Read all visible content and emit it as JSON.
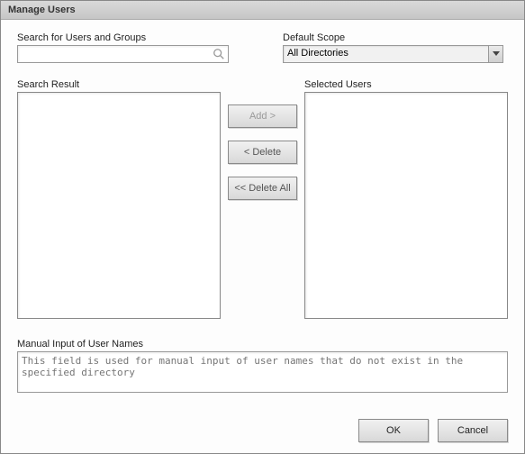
{
  "title": "Manage Users",
  "search": {
    "label": "Search for Users and Groups",
    "value": "",
    "placeholder": ""
  },
  "scope": {
    "label": "Default Scope",
    "selected": "All Directories"
  },
  "searchResult": {
    "label": "Search Result",
    "items": []
  },
  "selectedUsers": {
    "label": "Selected Users",
    "items": []
  },
  "buttons": {
    "add": "Add >",
    "delete": "< Delete",
    "deleteAll": "<< Delete All",
    "ok": "OK",
    "cancel": "Cancel"
  },
  "manual": {
    "label": "Manual Input of User Names",
    "placeholder": "This field is used for manual input of user names that do not exist in the specified directory",
    "value": ""
  }
}
